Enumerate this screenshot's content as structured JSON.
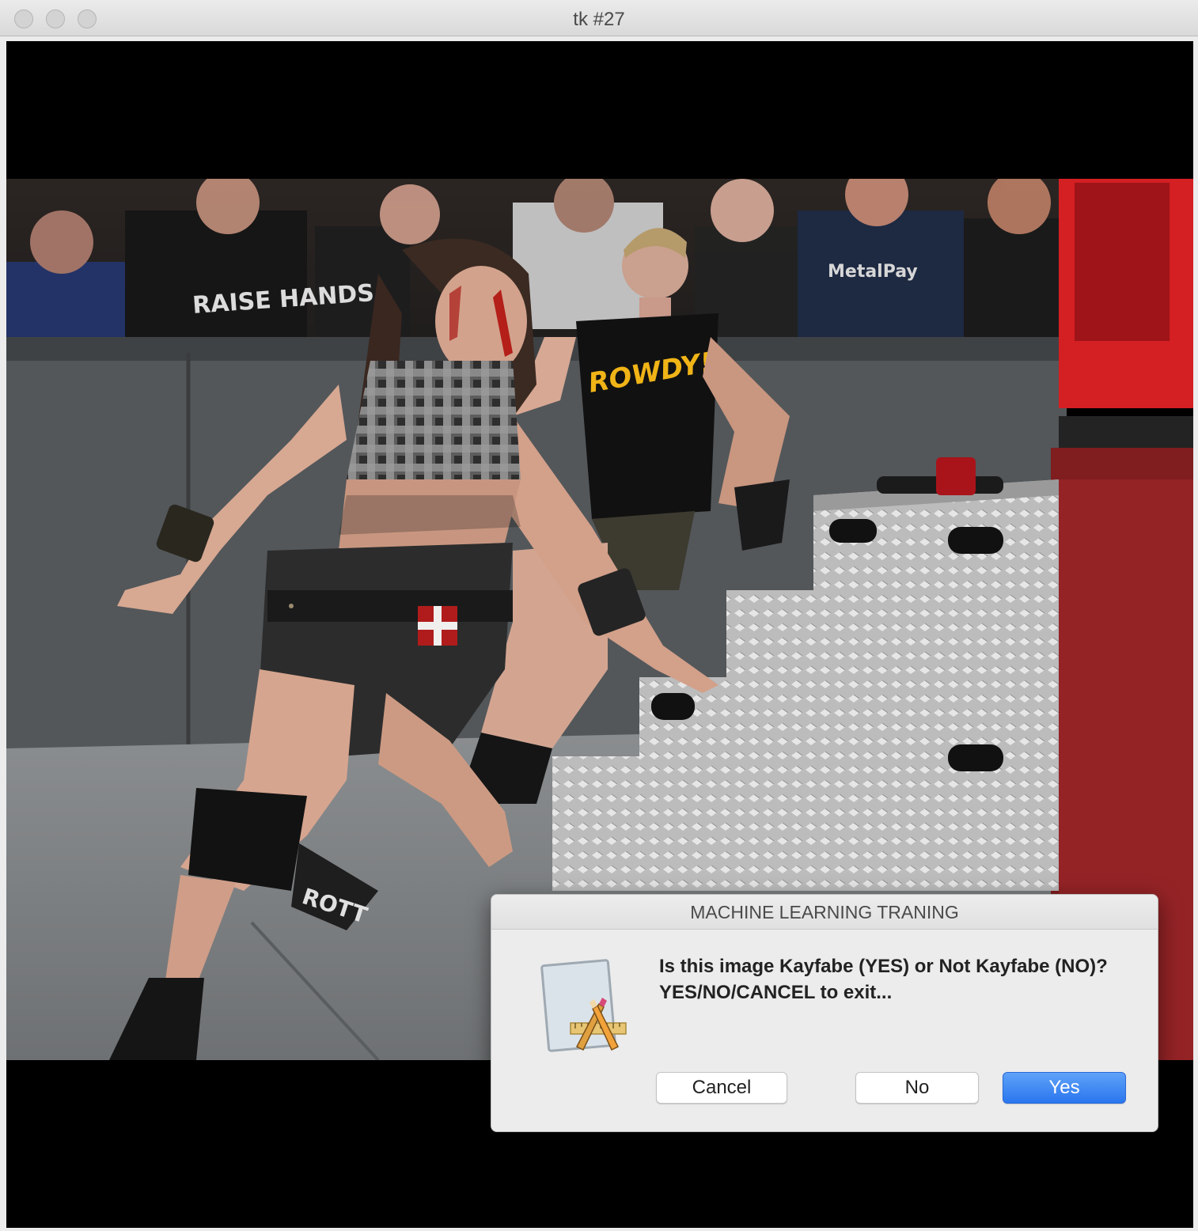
{
  "window": {
    "title": "tk #27"
  },
  "dialog": {
    "title": "MACHINE LEARNING TRANING",
    "message": "Is this image Kayfabe (YES) or Not Kayfabe (NO)?YES/NO/CANCEL to exit...",
    "buttons": {
      "cancel": "Cancel",
      "no": "No",
      "yes": "Yes"
    },
    "icon": "script-editor-icon",
    "accent_color": "#2f7bf0"
  },
  "photo": {
    "shirt_text": "ROWDY!",
    "sponsor_text": "MetalPay",
    "crowd_shirt_text": "RAISE HANDS",
    "kneepad_text": "ROTT"
  }
}
